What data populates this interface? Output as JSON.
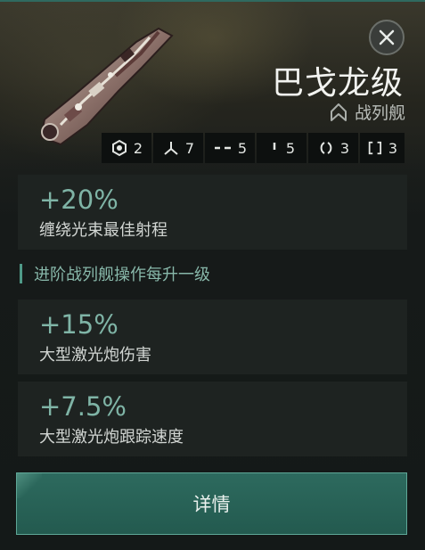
{
  "ship": {
    "name": "巴戈龙级",
    "class_label": "战列舰",
    "class_icon": "ship-class-chevron-icon",
    "image_icon": "battleship-render"
  },
  "slots": [
    {
      "icon": "high-slot-icon",
      "count": "2"
    },
    {
      "icon": "turret-hardpoint-icon",
      "count": "7"
    },
    {
      "icon": "mid-slot-icon",
      "count": "5"
    },
    {
      "icon": "low-slot-icon",
      "count": "5"
    },
    {
      "icon": "rig-slot-icon",
      "count": "3"
    },
    {
      "icon": "subsystem-slot-icon",
      "count": "3"
    }
  ],
  "role_bonus": {
    "value": "+20%",
    "desc": "缠绕光束最佳射程"
  },
  "skill_section_label": "进阶战列舰操作每升一级",
  "skill_bonuses": [
    {
      "value": "+15%",
      "desc": "大型激光炮伤害"
    },
    {
      "value": "+7.5%",
      "desc": "大型激光炮跟踪速度"
    }
  ],
  "details_button": "详情",
  "colors": {
    "accent": "#2d6a5e",
    "bonus_text": "#7fb4a6",
    "section_text": "#88b8aa"
  }
}
